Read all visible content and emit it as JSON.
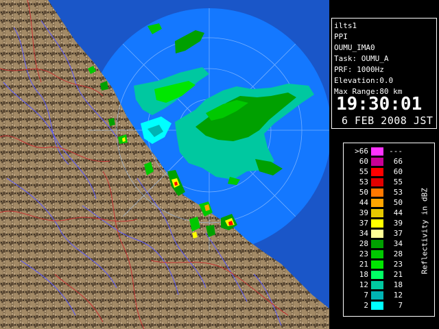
{
  "radar": {
    "station": "ilts1",
    "product": "PPI",
    "site": "OUMU_IMA0",
    "task": "Task: OUMU_A",
    "prf": "PRF: 1000Hz",
    "elevation": "Elevation:0.0",
    "max_range": "Max Range:80 km",
    "time": "19:30:01",
    "date": "6 FEB 2008 JST"
  },
  "legend": {
    "title": "Reflectivity in dBZ",
    "rows": [
      {
        "lo": ">66",
        "hi": "---",
        "color": "#ff33ff"
      },
      {
        "lo": "60",
        "hi": "66",
        "color": "#c80096"
      },
      {
        "lo": "55",
        "hi": "60",
        "color": "#ff0000"
      },
      {
        "lo": "53",
        "hi": "55",
        "color": "#e10000"
      },
      {
        "lo": "50",
        "hi": "53",
        "color": "#ff7800"
      },
      {
        "lo": "44",
        "hi": "50",
        "color": "#ffa500"
      },
      {
        "lo": "39",
        "hi": "44",
        "color": "#e6c800"
      },
      {
        "lo": "37",
        "hi": "39",
        "color": "#ffff00"
      },
      {
        "lo": "34",
        "hi": "37",
        "color": "#ffff96"
      },
      {
        "lo": "28",
        "hi": "34",
        "color": "#00a000"
      },
      {
        "lo": "23",
        "hi": "28",
        "color": "#00c800"
      },
      {
        "lo": "21",
        "hi": "23",
        "color": "#00e600"
      },
      {
        "lo": "18",
        "hi": "21",
        "color": "#00ff64"
      },
      {
        "lo": "12",
        "hi": "18",
        "color": "#00c8a0"
      },
      {
        "lo": "7",
        "hi": "12",
        "color": "#00b4b4"
      },
      {
        "lo": "2",
        "hi": "7",
        "color": "#00ffff"
      }
    ]
  }
}
